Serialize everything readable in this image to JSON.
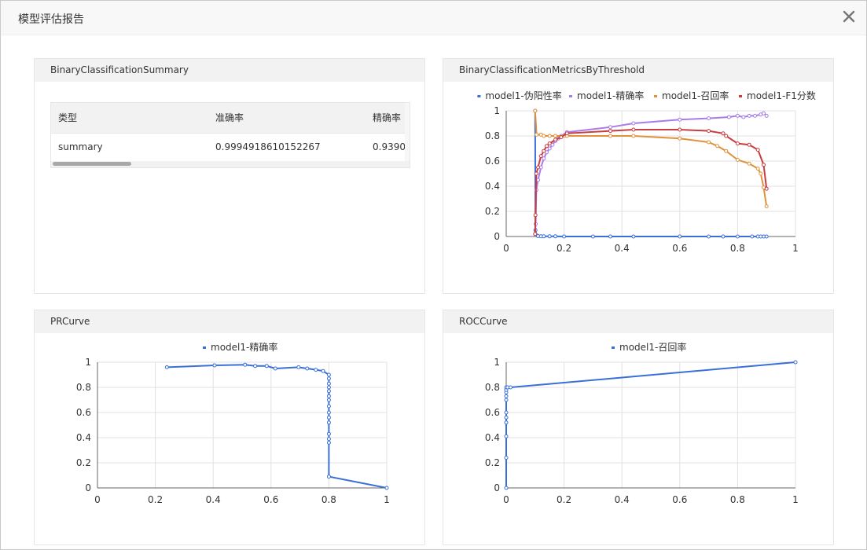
{
  "modal": {
    "title": "模型评估报告"
  },
  "panels": {
    "summary": {
      "title": "BinaryClassificationSummary",
      "columns": [
        "类型",
        "准确率",
        "精确率"
      ],
      "rows": [
        [
          "summary",
          "0.9994918610152267",
          "0.9390"
        ]
      ]
    },
    "threshold": {
      "title": "BinaryClassificationMetricsByThreshold"
    },
    "pr": {
      "title": "PRCurve"
    },
    "roc": {
      "title": "ROCCurve"
    }
  },
  "colors": {
    "blue": "#3a6fd8",
    "purple": "#a97de9",
    "orange": "#e0913a",
    "red": "#c93c3f"
  },
  "chart_data": [
    {
      "type": "line",
      "xlim": [
        0,
        1
      ],
      "ylim": [
        0,
        1
      ],
      "xticks": [
        "0",
        "0.2",
        "0.4",
        "0.6",
        "0.8",
        "1"
      ],
      "yticks": [
        "0",
        "0.2",
        "0.4",
        "0.6",
        "0.8",
        "1"
      ],
      "grid": true,
      "legend": "top",
      "series": [
        {
          "name": "model1-伪阳性率",
          "color": "#3a6fd8",
          "points": [
            [
              0.1,
              1
            ],
            [
              0.101,
              0.05
            ],
            [
              0.105,
              0.01
            ],
            [
              0.11,
              0.003
            ],
            [
              0.12,
              0.002
            ],
            [
              0.13,
              0.001
            ],
            [
              0.15,
              0.001
            ],
            [
              0.17,
              0.001
            ],
            [
              0.2,
              0
            ],
            [
              0.3,
              0
            ],
            [
              0.36,
              0
            ],
            [
              0.44,
              0
            ],
            [
              0.6,
              0
            ],
            [
              0.7,
              0
            ],
            [
              0.75,
              0
            ],
            [
              0.8,
              0
            ],
            [
              0.85,
              0
            ],
            [
              0.87,
              0
            ],
            [
              0.88,
              0
            ],
            [
              0.89,
              0
            ],
            [
              0.9,
              0
            ]
          ]
        },
        {
          "name": "model1-精确率",
          "color": "#a97de9",
          "points": [
            [
              0.1,
              0.02
            ],
            [
              0.102,
              0.1
            ],
            [
              0.104,
              0.37
            ],
            [
              0.11,
              0.45
            ],
            [
              0.12,
              0.55
            ],
            [
              0.13,
              0.62
            ],
            [
              0.14,
              0.67
            ],
            [
              0.15,
              0.7
            ],
            [
              0.16,
              0.73
            ],
            [
              0.17,
              0.76
            ],
            [
              0.18,
              0.78
            ],
            [
              0.19,
              0.8
            ],
            [
              0.21,
              0.83
            ],
            [
              0.36,
              0.87
            ],
            [
              0.44,
              0.9
            ],
            [
              0.6,
              0.93
            ],
            [
              0.7,
              0.94
            ],
            [
              0.77,
              0.95
            ],
            [
              0.8,
              0.96
            ],
            [
              0.82,
              0.95
            ],
            [
              0.84,
              0.96
            ],
            [
              0.86,
              0.96
            ],
            [
              0.88,
              0.97
            ],
            [
              0.89,
              0.98
            ],
            [
              0.9,
              0.96
            ]
          ]
        },
        {
          "name": "model1-召回率",
          "color": "#e0913a",
          "points": [
            [
              0.1,
              1
            ],
            [
              0.105,
              0.81
            ],
            [
              0.12,
              0.81
            ],
            [
              0.13,
              0.8
            ],
            [
              0.15,
              0.8
            ],
            [
              0.17,
              0.8
            ],
            [
              0.2,
              0.8
            ],
            [
              0.21,
              0.8
            ],
            [
              0.36,
              0.8
            ],
            [
              0.44,
              0.8
            ],
            [
              0.6,
              0.78
            ],
            [
              0.7,
              0.75
            ],
            [
              0.73,
              0.72
            ],
            [
              0.76,
              0.68
            ],
            [
              0.8,
              0.61
            ],
            [
              0.84,
              0.58
            ],
            [
              0.87,
              0.54
            ],
            [
              0.88,
              0.5
            ],
            [
              0.89,
              0.39
            ],
            [
              0.9,
              0.24
            ]
          ]
        },
        {
          "name": "model1-F1分数",
          "color": "#c93c3f",
          "points": [
            [
              0.1,
              0.02
            ],
            [
              0.101,
              0.17
            ],
            [
              0.104,
              0.5
            ],
            [
              0.11,
              0.55
            ],
            [
              0.12,
              0.64
            ],
            [
              0.13,
              0.68
            ],
            [
              0.14,
              0.72
            ],
            [
              0.15,
              0.74
            ],
            [
              0.17,
              0.77
            ],
            [
              0.19,
              0.79
            ],
            [
              0.21,
              0.82
            ],
            [
              0.36,
              0.84
            ],
            [
              0.44,
              0.85
            ],
            [
              0.6,
              0.85
            ],
            [
              0.7,
              0.84
            ],
            [
              0.75,
              0.82
            ],
            [
              0.76,
              0.8
            ],
            [
              0.8,
              0.74
            ],
            [
              0.84,
              0.73
            ],
            [
              0.87,
              0.69
            ],
            [
              0.89,
              0.57
            ],
            [
              0.9,
              0.38
            ]
          ]
        }
      ]
    },
    {
      "type": "line",
      "xlim": [
        0,
        1
      ],
      "ylim": [
        0,
        1
      ],
      "xticks": [
        "0",
        "0.2",
        "0.4",
        "0.6",
        "0.8",
        "1"
      ],
      "yticks": [
        "0",
        "0.2",
        "0.4",
        "0.6",
        "0.8",
        "1"
      ],
      "grid": true,
      "legend": "top",
      "series": [
        {
          "name": "model1-精确率",
          "color": "#3a6fd8",
          "points": [
            [
              0.24,
              0.96
            ],
            [
              0.405,
              0.975
            ],
            [
              0.51,
              0.98
            ],
            [
              0.545,
              0.97
            ],
            [
              0.585,
              0.97
            ],
            [
              0.615,
              0.95
            ],
            [
              0.695,
              0.96
            ],
            [
              0.725,
              0.95
            ],
            [
              0.755,
              0.94
            ],
            [
              0.78,
              0.93
            ],
            [
              0.8,
              0.9
            ],
            [
              0.8,
              0.87
            ],
            [
              0.8,
              0.83
            ],
            [
              0.8,
              0.8
            ],
            [
              0.8,
              0.77
            ],
            [
              0.8,
              0.73
            ],
            [
              0.8,
              0.7
            ],
            [
              0.8,
              0.65
            ],
            [
              0.8,
              0.6
            ],
            [
              0.8,
              0.56
            ],
            [
              0.8,
              0.52
            ],
            [
              0.8,
              0.43
            ],
            [
              0.8,
              0.39
            ],
            [
              0.8,
              0.36
            ],
            [
              0.8,
              0.09
            ],
            [
              1,
              0
            ]
          ]
        }
      ]
    },
    {
      "type": "line",
      "xlim": [
        0,
        1
      ],
      "ylim": [
        0,
        1
      ],
      "xticks": [
        "0",
        "0.2",
        "0.4",
        "0.6",
        "0.8",
        "1"
      ],
      "yticks": [
        "0",
        "0.2",
        "0.4",
        "0.6",
        "0.8",
        "1"
      ],
      "grid": true,
      "legend": "top",
      "series": [
        {
          "name": "model1-召回率",
          "color": "#3a6fd8",
          "points": [
            [
              0,
              0
            ],
            [
              0,
              0.24
            ],
            [
              0,
              0.41
            ],
            [
              0,
              0.52
            ],
            [
              0,
              0.56
            ],
            [
              0,
              0.6
            ],
            [
              0,
              0.7
            ],
            [
              0,
              0.73
            ],
            [
              0,
              0.76
            ],
            [
              0,
              0.78
            ],
            [
              0,
              0.8
            ],
            [
              0.005,
              0.8
            ],
            [
              0.015,
              0.8
            ],
            [
              1,
              1
            ]
          ]
        }
      ]
    }
  ]
}
